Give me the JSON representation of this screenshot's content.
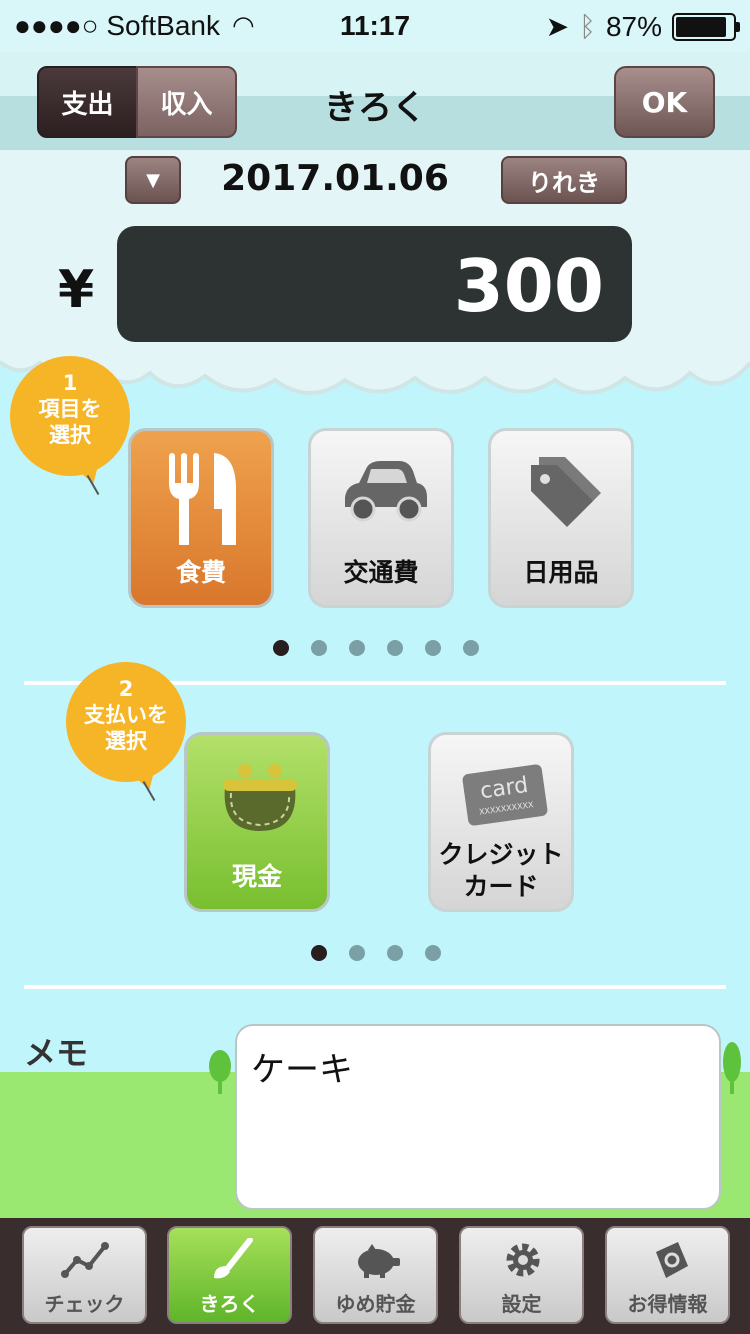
{
  "status": {
    "carrier": "●●●●○ SoftBank",
    "time": "11:17",
    "battery": "87%"
  },
  "nav": {
    "expense": "支出",
    "income": "収入",
    "title": "きろく",
    "ok": "OK"
  },
  "date": {
    "value": "2017.01.06",
    "history": "りれき"
  },
  "amount": {
    "currency": "¥",
    "value": "300"
  },
  "step1": {
    "num": "1",
    "line1": "項目を",
    "line2": "選択"
  },
  "categories": [
    {
      "label": "食費",
      "icon": "fork-knife-icon",
      "selected": true
    },
    {
      "label": "交通費",
      "icon": "car-icon",
      "selected": false
    },
    {
      "label": "日用品",
      "icon": "tag-icon",
      "selected": false
    }
  ],
  "category_pages": {
    "count": 6,
    "current": 0
  },
  "step2": {
    "num": "2",
    "line1": "支払いを",
    "line2": "選択"
  },
  "payments": [
    {
      "label": "現金",
      "icon": "purse-icon",
      "selected": true
    },
    {
      "label1": "クレジット",
      "label2": "カード",
      "icon": "card-icon",
      "card_text": "card",
      "card_num": "XXXXXXXXXX",
      "selected": false
    }
  ],
  "payment_pages": {
    "count": 4,
    "current": 0
  },
  "memo": {
    "label": "メモ",
    "value": "ケーキ"
  },
  "tabs": [
    {
      "label": "チェック",
      "icon": "chart-line-icon"
    },
    {
      "label": "きろく",
      "icon": "brush-icon",
      "active": true
    },
    {
      "label": "ゆめ貯金",
      "icon": "piggy-bank-icon"
    },
    {
      "label": "設定",
      "icon": "gear-icon"
    },
    {
      "label": "お得情報",
      "icon": "coupon-bag-icon"
    }
  ],
  "colors": {
    "sky": "#bff5fb",
    "orange": "#e0842f",
    "green": "#86c93a",
    "dark": "#2d3232",
    "bubble": "#f6b427"
  }
}
